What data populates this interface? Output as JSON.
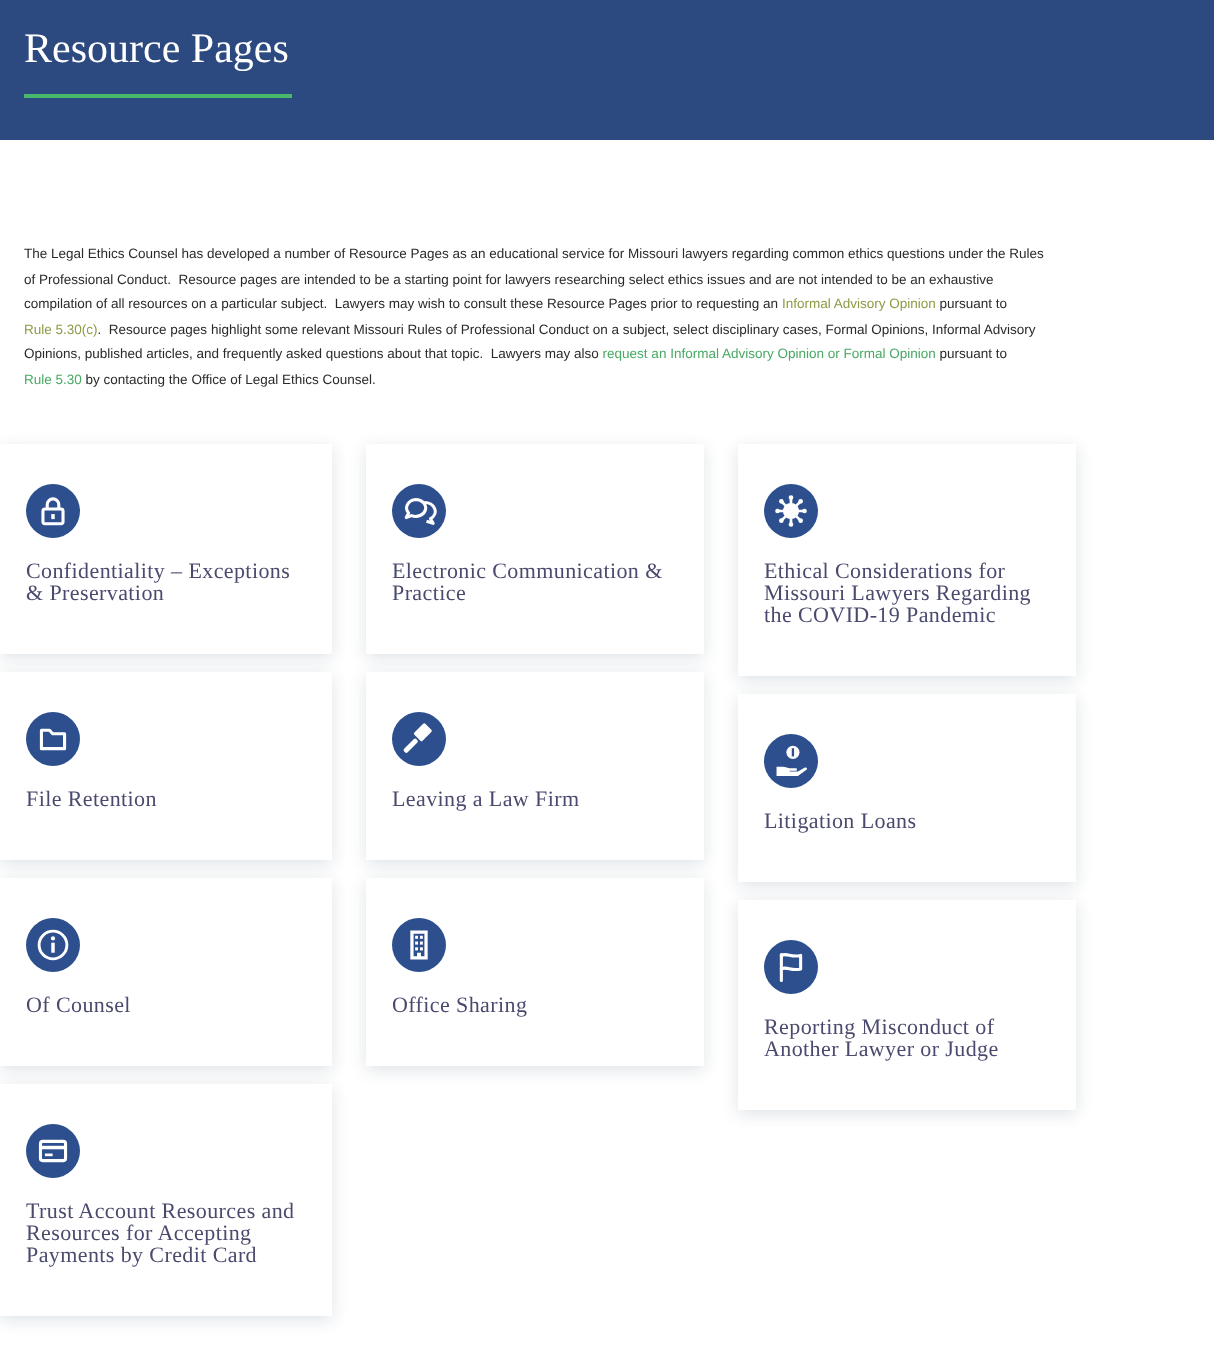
{
  "header": {
    "title": "Resource Pages"
  },
  "intro": [
    {
      "kind": "text",
      "text": "The Legal Ethics Counsel has developed a number of Resource Pages as an educational service for Missouri lawyers regarding common ethics questions under the Rules of Professional Conduct.  Resource pages are intended to be a starting point for lawyers researching select ethics issues and are not intended to be an exhaustive compilation of all resources on a particular subject.  Lawyers may wish to consult these Resource Pages prior to requesting an "
    },
    {
      "kind": "link",
      "text": "Informal Advisory Opinion",
      "visited": true
    },
    {
      "kind": "text",
      "text": " pursuant to "
    },
    {
      "kind": "link",
      "text": "Rule 5.30(c)",
      "visited": true
    },
    {
      "kind": "text",
      "text": ".  Resource pages highlight some relevant Missouri Rules of Professional Conduct on a subject, select disciplinary cases, Formal Opinions, Informal Advisory Opinions, published articles, and frequently asked questions about that topic.  Lawyers may also "
    },
    {
      "kind": "link",
      "text": "request an Informal Advisory Opinion or Formal Opinion",
      "visited": false
    },
    {
      "kind": "text",
      "text": " pursuant to "
    },
    {
      "kind": "link",
      "text": "Rule 5.30",
      "visited": false
    },
    {
      "kind": "text",
      "text": " by contacting the Office of Legal Ethics Counsel."
    }
  ],
  "resources": [
    {
      "kind": "lock",
      "title": "Confidentiality – Exceptions & Preservation"
    },
    {
      "kind": "chat",
      "title": "Electronic Communication & Practice"
    },
    {
      "kind": "virus",
      "title": "Ethical Considerations for Missouri Lawyers Regarding the COVID-19 Pandemic"
    },
    {
      "kind": "folder",
      "title": "File Retention"
    },
    {
      "kind": "gavel",
      "title": "Leaving a Law Firm"
    },
    {
      "kind": "hand-coin",
      "title": "Litigation Loans"
    },
    {
      "kind": "info",
      "title": "Of Counsel"
    },
    {
      "kind": "building",
      "title": "Office Sharing"
    },
    {
      "kind": "flag",
      "title": "Reporting Misconduct of Another Lawyer or Judge"
    },
    {
      "kind": "card",
      "title": "Trust Account Resources and Resources for Accepting Payments by Credit Card"
    }
  ]
}
